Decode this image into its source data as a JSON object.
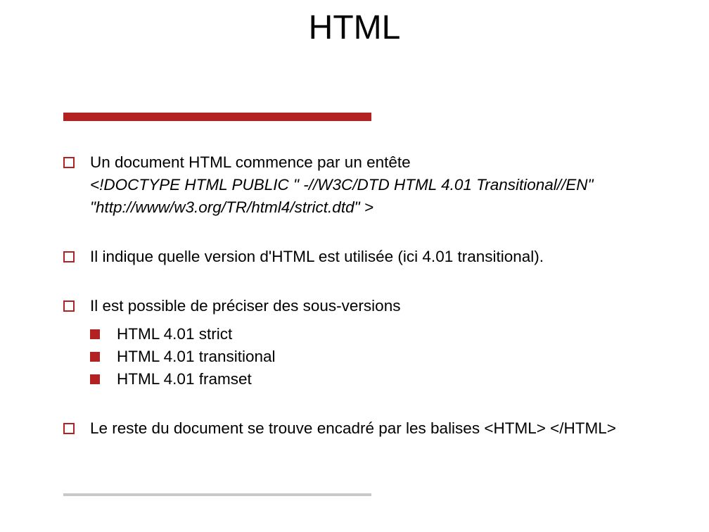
{
  "title": "HTML",
  "bullets": {
    "b1": "Un document HTML commence par un entête",
    "doctype_line1": "<!DOCTYPE HTML PUBLIC  \" -//W3C/DTD HTML 4.01 Transitional//EN\"",
    "doctype_line2": "\"http://www/w3.org/TR/html4/strict.dtd\"  >",
    "b2": "Il indique quelle version d'HTML est utilisée (ici 4.01 transitional).",
    "b3": "Il est possible de préciser des sous-versions",
    "sub1": "HTML 4.01 strict",
    "sub2": "HTML 4.01 transitional",
    "sub3": "HTML 4.01 framset",
    "b4": "Le reste du document se trouve encadré par les balises <HTML> </HTML>"
  }
}
